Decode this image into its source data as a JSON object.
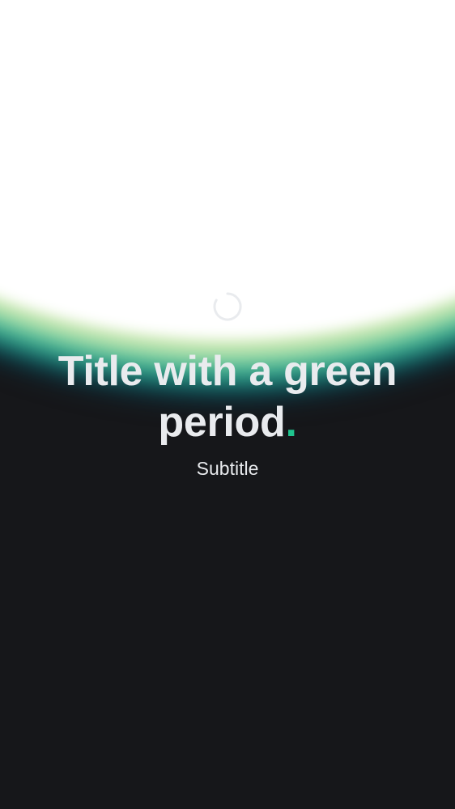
{
  "header": {
    "title_text": "Title with a green period",
    "title_period": ".",
    "subtitle": "Subtitle"
  },
  "colors": {
    "background": "#16171a",
    "accent": "#1fc48e",
    "text": "#e9ebee"
  },
  "icons": {
    "loading": "spinner-icon"
  }
}
